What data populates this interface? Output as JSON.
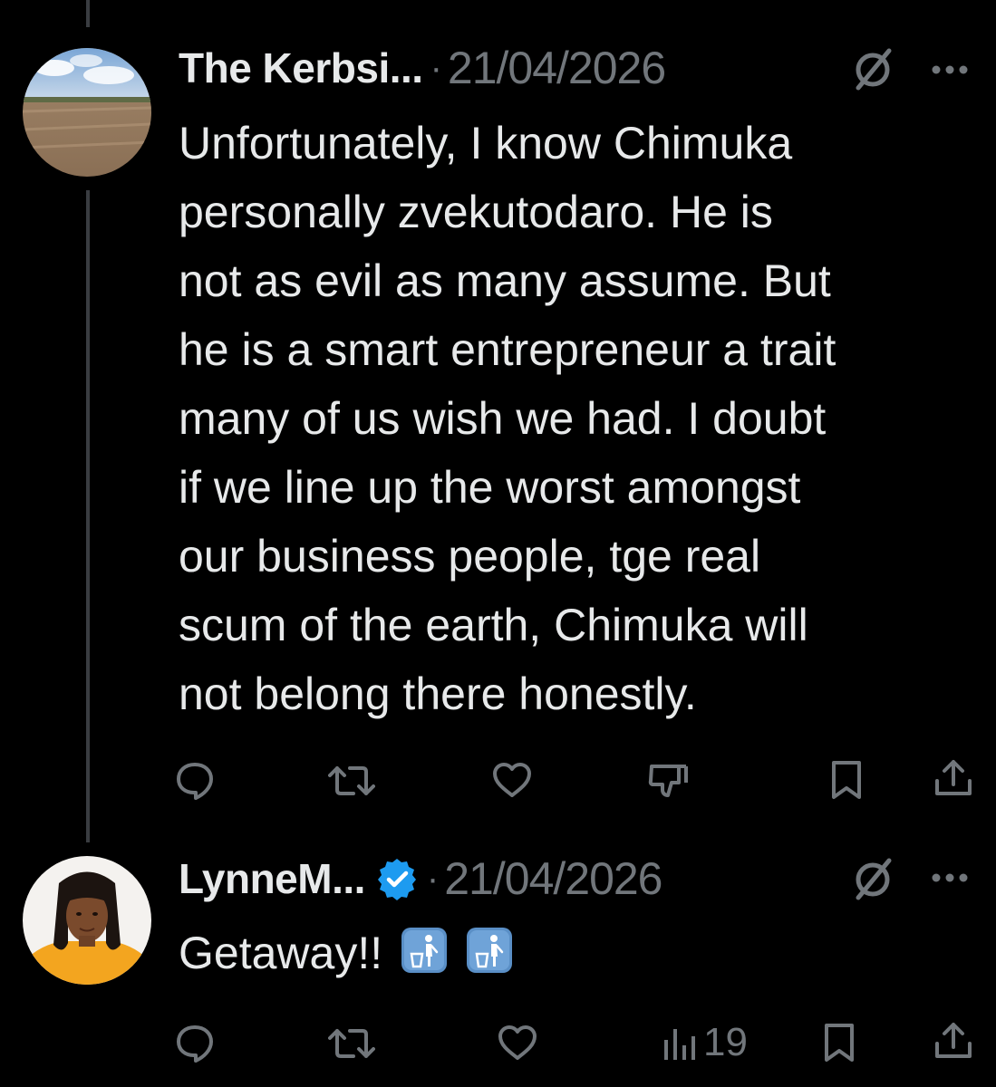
{
  "thread": [
    {
      "author_name": "The Kerbsi...",
      "separator": "·",
      "date": "21/04/2026",
      "verified": false,
      "avatar_icon": "field-landscape-avatar",
      "body_lines": [
        "Unfortunately, I know Chimuka",
        "personally zvekutodaro. He is",
        "not as evil as many assume. But",
        "he is a smart entrepreneur a trait",
        "many of us wish we had. I doubt",
        "if we line up the worst amongst",
        "our business people, tge real",
        "scum of the earth, Chimuka will",
        "not belong there honestly."
      ],
      "actions": [
        "reply-icon",
        "retweet-icon",
        "like-icon",
        "dislike-icon",
        "bookmark-icon",
        "share-icon"
      ]
    },
    {
      "author_name": "LynneM...",
      "separator": "·",
      "date": "21/04/2026",
      "verified": true,
      "avatar_icon": "woman-portrait-avatar",
      "body_text": "Getaway!!",
      "body_emojis": [
        "put-litter-in-its-place-emoji",
        "put-litter-in-its-place-emoji"
      ],
      "views_count": "19",
      "actions": [
        "reply-icon",
        "retweet-icon",
        "like-icon",
        "views-icon",
        "bookmark-icon",
        "share-icon"
      ]
    }
  ],
  "colors": {
    "background": "#000000",
    "text_primary": "#e7e9ea",
    "text_secondary": "#71767b",
    "thread_line": "#3a3d41",
    "verified_badge": "#1d9bf0"
  }
}
